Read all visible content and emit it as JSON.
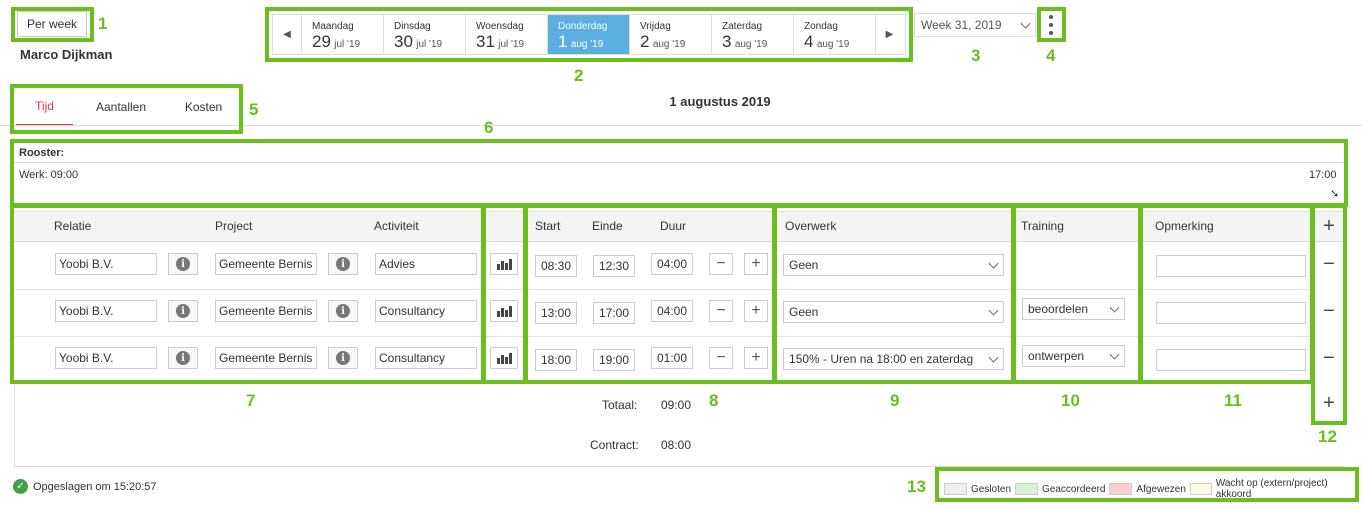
{
  "header": {
    "period_button": "Per week",
    "user_name": "Marco Dijkman",
    "week_select": "Week 31, 2019",
    "days": [
      {
        "name": "Maandag",
        "num": "29",
        "month": "jul '19",
        "active": false
      },
      {
        "name": "Dinsdag",
        "num": "30",
        "month": "jul '19",
        "active": false
      },
      {
        "name": "Woensdag",
        "num": "31",
        "month": "jul '19",
        "active": false
      },
      {
        "name": "Donderdag",
        "num": "1",
        "month": "aug '19",
        "active": true
      },
      {
        "name": "Vrijdag",
        "num": "2",
        "month": "aug '19",
        "active": false
      },
      {
        "name": "Zaterdag",
        "num": "3",
        "month": "aug '19",
        "active": false
      },
      {
        "name": "Zondag",
        "num": "4",
        "month": "aug '19",
        "active": false
      }
    ]
  },
  "tabs": [
    "Tijd",
    "Aantallen",
    "Kosten"
  ],
  "date_title": "1 augustus 2019",
  "rooster": {
    "label": "Rooster:",
    "start": "Werk: 09:00",
    "end": "17:00",
    "arrow": "➘"
  },
  "columns": {
    "relatie": "Relatie",
    "project": "Project",
    "activiteit": "Activiteit",
    "start": "Start",
    "einde": "Einde",
    "duur": "Duur",
    "overwerk": "Overwerk",
    "training": "Training",
    "opmerking": "Opmerking"
  },
  "rows": [
    {
      "relatie": "Yoobi B.V.",
      "project": "Gemeente Bernis",
      "activiteit": "Advies",
      "start": "08:30",
      "einde": "12:30",
      "duur": "04:00",
      "overwerk": "Geen",
      "training": "",
      "opmerking": ""
    },
    {
      "relatie": "Yoobi B.V.",
      "project": "Gemeente Bernis",
      "activiteit": "Consultancy",
      "start": "13:00",
      "einde": "17:00",
      "duur": "04:00",
      "overwerk": "Geen",
      "training": "beoordelen",
      "opmerking": ""
    },
    {
      "relatie": "Yoobi B.V.",
      "project": "Gemeente Bernis",
      "activiteit": "Consultancy",
      "start": "18:00",
      "einde": "19:00",
      "duur": "01:00",
      "overwerk": "150% - Uren na 18:00 en zaterdag",
      "training": "ontwerpen",
      "opmerking": ""
    }
  ],
  "totals": {
    "totaal_label": "Totaal:",
    "totaal_value": "09:00",
    "contract_label": "Contract:",
    "contract_value": "08:00"
  },
  "status": {
    "saved_text": "Opgeslagen om 15:20:57"
  },
  "legend": [
    {
      "label": "Gesloten",
      "color": "#eeeeee"
    },
    {
      "label": "Geaccordeerd",
      "color": "#d9f2d9"
    },
    {
      "label": "Afgewezen",
      "color": "#f9d0d0"
    },
    {
      "label": "Wacht op (extern/project) akkoord",
      "color": "#fdfbe6"
    }
  ],
  "icons": {
    "info": "i",
    "plus": "+",
    "minus": "−",
    "check": "✓",
    "prev": "◀",
    "next": "▶"
  },
  "callouts": [
    "1",
    "2",
    "3",
    "4",
    "5",
    "6",
    "7",
    "8",
    "9",
    "10",
    "11",
    "12",
    "13"
  ],
  "highlight_color": "#6abf1e"
}
